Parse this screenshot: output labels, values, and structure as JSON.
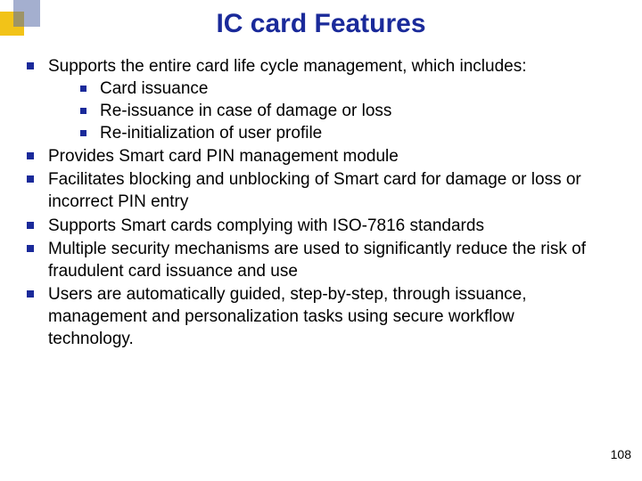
{
  "title": "IC card Features",
  "bullets": {
    "b1": "Supports the entire card life cycle management, which includes:",
    "b1_sub1": "Card issuance",
    "b1_sub2": "Re-issuance in case of damage or loss",
    "b1_sub3": "Re-initialization of user profile",
    "b2": "Provides Smart card PIN management module",
    "b3": "Facilitates blocking and unblocking of Smart card for damage or loss or incorrect PIN entry",
    "b4": "Supports Smart cards complying with ISO-7816 standards",
    "b5": "Multiple security mechanisms are used to significantly reduce the risk of fraudulent card issuance and use",
    "b6": "Users are automatically guided, step-by-step, through issuance, management and personalization tasks using secure workflow technology."
  },
  "page_number": "108"
}
